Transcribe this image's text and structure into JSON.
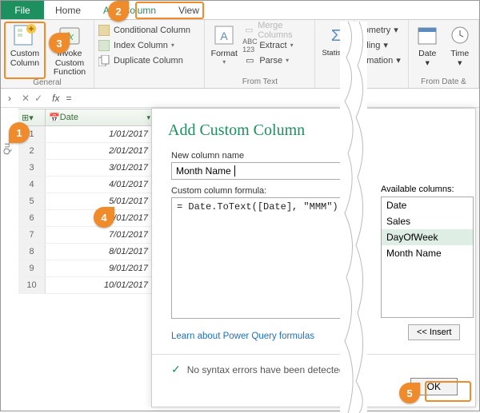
{
  "tabs": {
    "file": "File",
    "home": "Home",
    "add_column": "Add Column",
    "view": "View"
  },
  "ribbon": {
    "custom_column": "Custom\nColumn",
    "invoke_custom_function": "Invoke Custom\nFunction",
    "conditional_column": "Conditional Column",
    "index_column": "Index Column",
    "duplicate_column": "Duplicate Column",
    "format": "Format",
    "merge_columns": "Merge Columns",
    "extract": "Extract",
    "parse": "Parse",
    "statistics": "Statistics",
    "nometry": "nometry",
    "nding": "nding",
    "ormation": "ormation",
    "date": "Date",
    "time": "Time",
    "group_general": "General",
    "group_from_text": "From Text",
    "group_from_date": "From Date &"
  },
  "formula_bar": {
    "eq": "="
  },
  "grid": {
    "headers": {
      "blank": "",
      "date": "Date",
      "col3": "1!"
    },
    "rows": [
      {
        "n": "1",
        "date": "1/01/2017"
      },
      {
        "n": "2",
        "date": "2/01/2017"
      },
      {
        "n": "3",
        "date": "3/01/2017"
      },
      {
        "n": "4",
        "date": "4/01/2017"
      },
      {
        "n": "5",
        "date": "5/01/2017"
      },
      {
        "n": "6",
        "date": "6/01/2017"
      },
      {
        "n": "7",
        "date": "7/01/2017"
      },
      {
        "n": "8",
        "date": "8/01/2017"
      },
      {
        "n": "9",
        "date": "9/01/2017"
      },
      {
        "n": "10",
        "date": "10/01/2017"
      }
    ]
  },
  "dialog": {
    "title": "Add Custom Column",
    "new_col_label": "New column name",
    "new_col_value": "Month Name",
    "formula_label": "Custom column formula:",
    "formula_value": "= Date.ToText([Date], \"MMM\")",
    "available_label": "Available columns:",
    "available": [
      "Date",
      "Sales",
      "DayOfWeek",
      "Month Name"
    ],
    "insert": "<< Insert",
    "learn": "Learn about Power Query formulas",
    "status": "No syntax errors have been detected.",
    "ok": "OK"
  },
  "callouts": {
    "c1": "1",
    "c2": "2",
    "c3": "3",
    "c4": "4",
    "c5": "5"
  },
  "sidebar_label": "Qu"
}
